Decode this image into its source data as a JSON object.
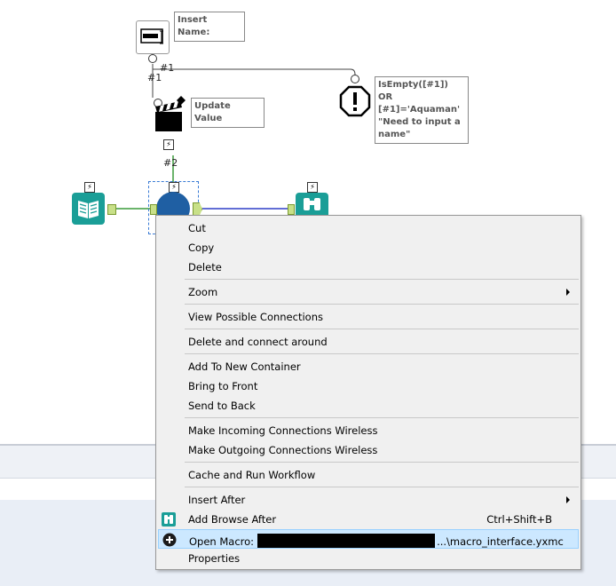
{
  "canvas": {
    "tools": {
      "text_input_label": "Insert Name:",
      "action_label": "Update Value",
      "error_label": "IsEmpty([#1]) OR [#1]='Aquaman' \"Need to input a name\""
    },
    "connections": {
      "c1_top": "#1",
      "c1_left": "#1",
      "c2": "#2"
    }
  },
  "context_menu": {
    "items": [
      {
        "label": "Cut"
      },
      {
        "label": "Copy"
      },
      {
        "label": "Delete"
      },
      {
        "label": "Zoom"
      },
      {
        "label": "View Possible Connections"
      },
      {
        "label": "Delete and connect around"
      },
      {
        "label": "Add To New Container"
      },
      {
        "label": "Bring to Front"
      },
      {
        "label": "Send to Back"
      },
      {
        "label": "Make Incoming Connections Wireless"
      },
      {
        "label": "Make Outgoing Connections Wireless"
      },
      {
        "label": "Cache and Run Workflow"
      },
      {
        "label": "Insert After"
      },
      {
        "label": "Add Browse After",
        "shortcut": "Ctrl+Shift+B"
      },
      {
        "label": "Open Macro:",
        "path_suffix": "...\\macro_interface.yxmc"
      },
      {
        "label": "Properties"
      }
    ]
  },
  "colors": {
    "teal": "#1a9e97",
    "macro_blue": "#1f5fa3",
    "green_conn": "#3a9b3a",
    "blue_conn": "#2e3fc7",
    "highlight": "#cce8ff"
  }
}
